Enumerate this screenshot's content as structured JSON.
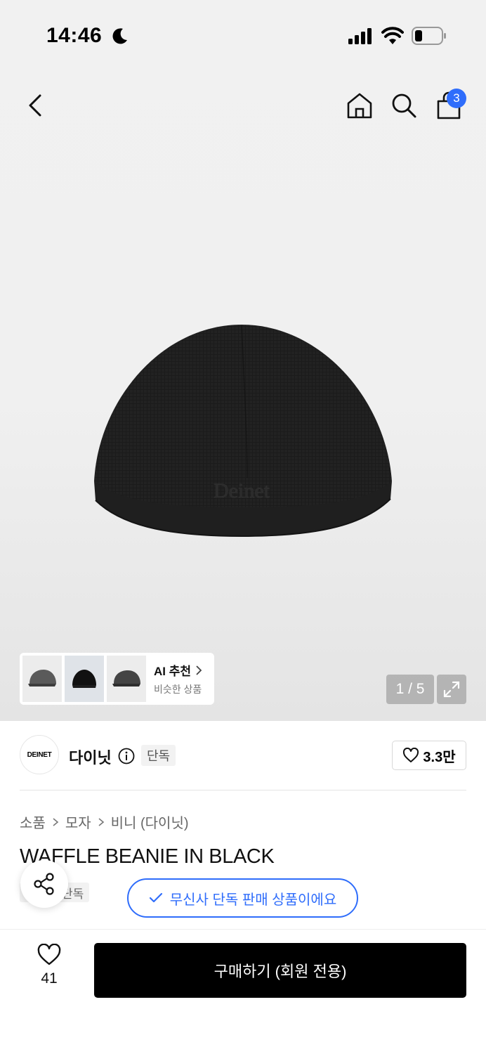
{
  "status_bar": {
    "time": "14:46"
  },
  "header": {
    "cart_count": "3"
  },
  "gallery": {
    "page_indicator": "1 / 5",
    "ai_recommend": {
      "title": "AI 추천",
      "subtitle": "비슷한 상품"
    }
  },
  "brand": {
    "logo_text": "DEINET",
    "name": "다이닛",
    "tag": "단독",
    "likes": "3.3만"
  },
  "breadcrumb": [
    "소품",
    "모자",
    "비니 (다이닛)"
  ],
  "product": {
    "title": "WAFFLE BEANIE IN BLACK",
    "tag": "단독"
  },
  "exclusive_banner": "무신사 단독 판매 상품이에요",
  "bottom_bar": {
    "wish_count": "41",
    "buy_label": "구매하기 (회원 전용)"
  },
  "colors": {
    "accent": "#2f6dfb",
    "buy_button": "#000000"
  }
}
